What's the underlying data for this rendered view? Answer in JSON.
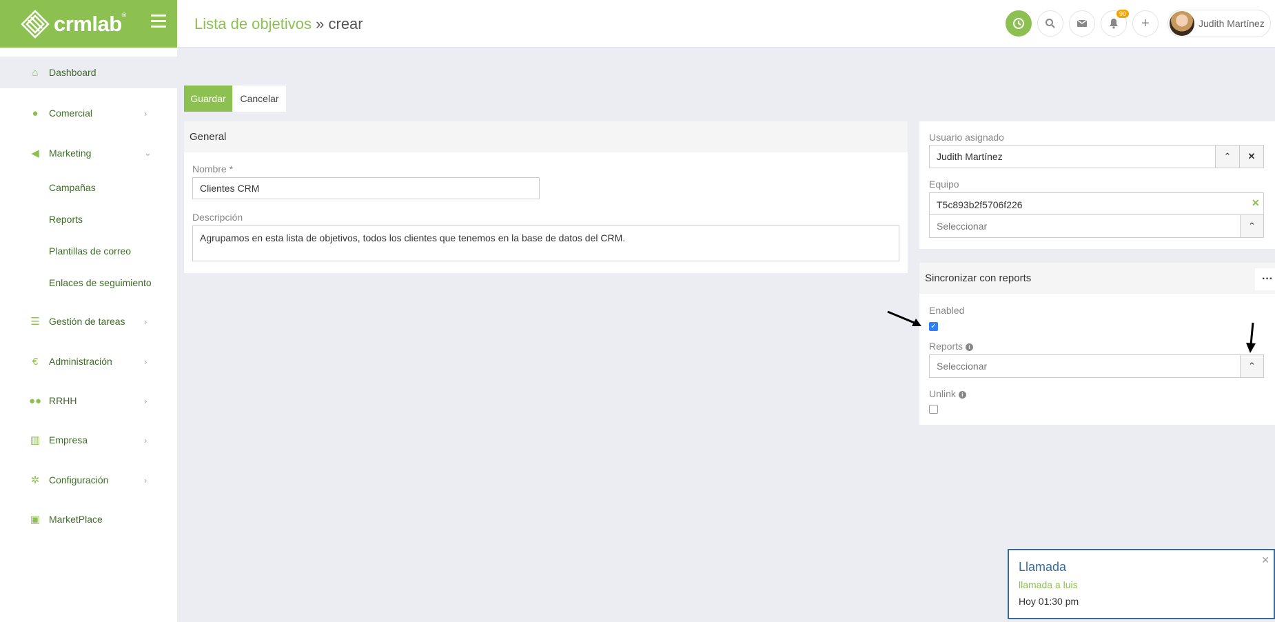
{
  "brand": {
    "name": "crmlab",
    "mark": "®"
  },
  "header": {
    "title": "Lista de objetivos",
    "separator": "»",
    "subtitle": "crear",
    "notifications_count": "90",
    "user_name": "Judith Martínez"
  },
  "sidebar": {
    "items": [
      {
        "label": "Dashboard",
        "icon": "home-icon"
      },
      {
        "label": "Comercial",
        "icon": "user-icon"
      },
      {
        "label": "Marketing",
        "icon": "megaphone-icon"
      },
      {
        "label": "Gestión de tareas",
        "icon": "tasks-icon"
      },
      {
        "label": "Administración",
        "icon": "euro-icon"
      },
      {
        "label": "RRHH",
        "icon": "users-icon"
      },
      {
        "label": "Empresa",
        "icon": "building-icon"
      },
      {
        "label": "Configuración",
        "icon": "gear-icon"
      },
      {
        "label": "MarketPlace",
        "icon": "bag-icon"
      }
    ],
    "marketing_subitems": [
      "Campañas",
      "Reports",
      "Plantillas de correo",
      "Enlaces de seguimiento"
    ]
  },
  "actions": {
    "save": "Guardar",
    "cancel": "Cancelar"
  },
  "general": {
    "title": "General",
    "name_label": "Nombre *",
    "name_value": "Clientes CRM",
    "description_label": "Descripción",
    "description_value": "Agrupamos en esta lista de objetivos, todos los clientes que tenemos en la base de datos del CRM."
  },
  "assignment": {
    "user_label": "Usuario asignado",
    "user_value": "Judith Martínez",
    "team_label": "Equipo",
    "team_value": "T5c893b2f5706f226",
    "team_select_placeholder": "Seleccionar"
  },
  "sync": {
    "title": "Sincronizar con reports",
    "enabled_label": "Enabled",
    "enabled": true,
    "reports_label": "Reports",
    "reports_placeholder": "Seleccionar",
    "unlink_label": "Unlink",
    "unlink": false
  },
  "toast": {
    "title": "Llamada",
    "subtitle": "llamada a luis",
    "time": "Hoy 01:30 pm"
  },
  "colors": {
    "brand_green": "#8cc152",
    "toast_border": "#3a6a96"
  }
}
